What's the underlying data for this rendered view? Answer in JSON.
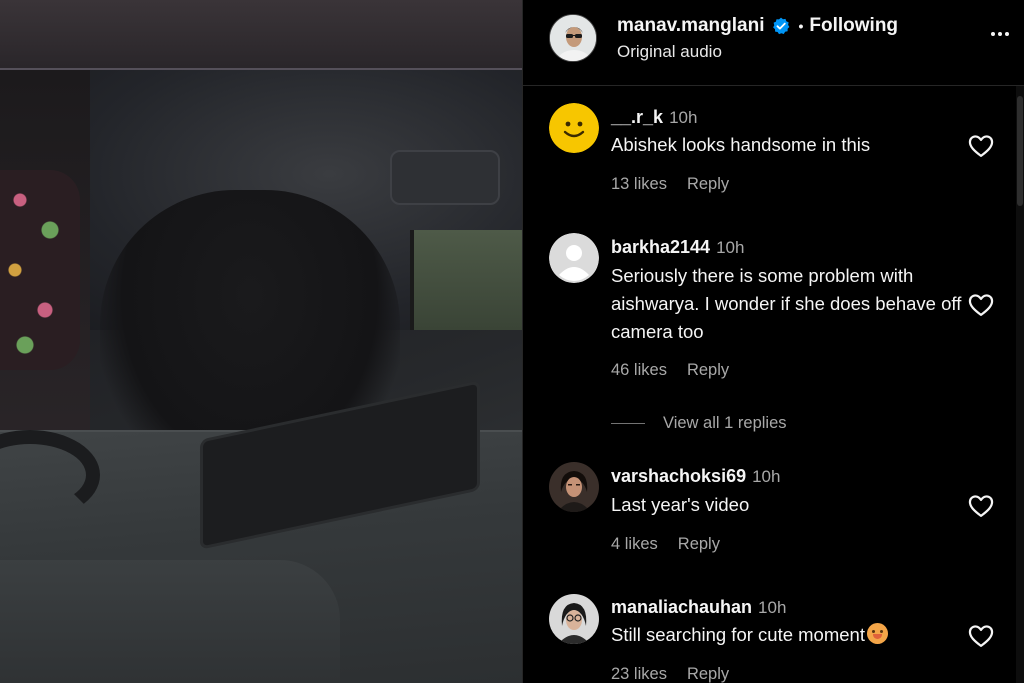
{
  "post": {
    "username": "manav.manglani",
    "dot": "•",
    "follow_status": "Following",
    "audio": "Original audio",
    "icons": {
      "avatar": "profile-photo",
      "verified": "verified-badge-icon",
      "more": "more-options-icon"
    }
  },
  "comments": [
    {
      "username": "__.r_k",
      "time": "10h",
      "text": "Abishek looks handsome in this",
      "likes": "13 likes",
      "reply": "Reply",
      "avatar": "smiley-emoji-avatar"
    },
    {
      "username": "barkha2144",
      "time": "10h",
      "text": "Seriously there is some problem with aishwarya. I wonder if she does behave off camera too",
      "likes": "46 likes",
      "reply": "Reply",
      "avatar": "default-avatar"
    },
    {
      "username": "varshachoksi69",
      "time": "10h",
      "text": "Last year's video",
      "likes": "4 likes",
      "reply": "Reply",
      "avatar": "profile-photo"
    },
    {
      "username": "manaliachauhan",
      "time": "10h",
      "text": "Still searching for cute moment",
      "likes": "23 likes",
      "reply": "Reply",
      "avatar": "profile-photo"
    }
  ],
  "view_replies": "View all 1 replies",
  "colors": {
    "background": "#000000",
    "text": "#f5f5f5",
    "secondary_text": "#a8a8a8",
    "verified": "#0095f6",
    "emoji_avatar": "#f7c600"
  }
}
